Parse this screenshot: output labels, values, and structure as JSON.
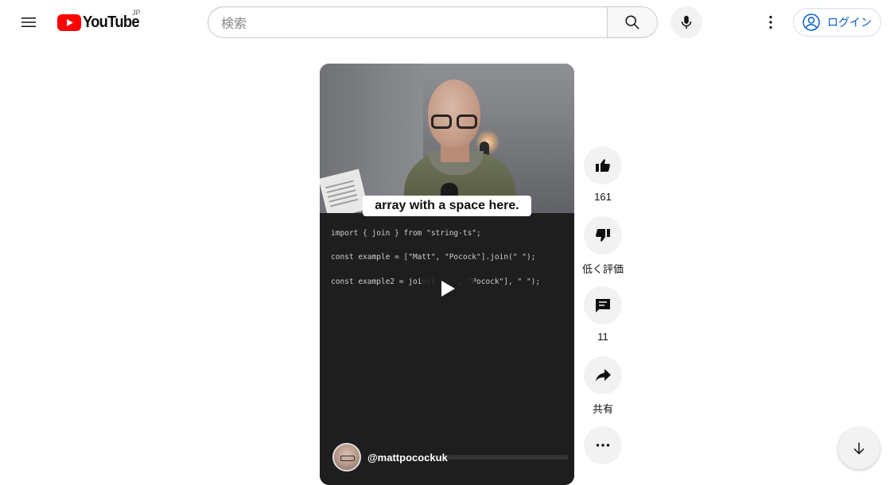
{
  "header": {
    "logo_text": "YouTube",
    "region_code": "JP",
    "search_placeholder": "検索",
    "login_label": "ログイン"
  },
  "video": {
    "caption": "array with a space here.",
    "code_lines": [
      "import { join } from \"string-ts\";",
      "const example = [\"Matt\", \"Pocock\"].join(\" \");",
      "const example2 = join([     , \"Pocock\"], \" \");"
    ],
    "channel_handle": "@mattpocockuk"
  },
  "actions": {
    "like_count": "161",
    "dislike_label": "低く評価",
    "comment_count": "11",
    "share_label": "共有"
  },
  "icons": {
    "menu": "menu-icon",
    "search": "search-icon",
    "mic": "mic-icon",
    "more": "more-vert-icon",
    "account": "account-circle-icon",
    "like": "thumb-up-icon",
    "dislike": "thumb-down-icon",
    "comment": "comment-icon",
    "share": "share-icon",
    "more_actions": "more-horiz-icon",
    "scroll_down": "arrow-down-icon",
    "play": "play-icon"
  },
  "colors": {
    "brand_red": "#ff0000",
    "link_blue": "#065fd4",
    "action_bg": "#f2f2f2"
  }
}
